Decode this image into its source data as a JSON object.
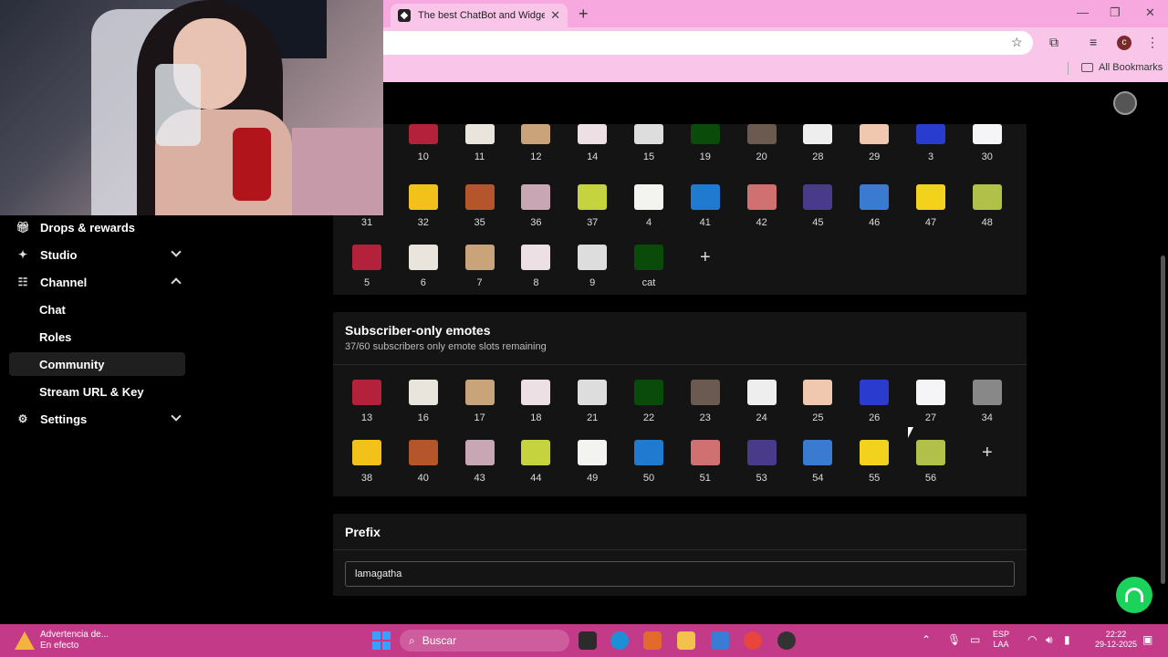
{
  "browser": {
    "tab_title": "The best ChatBot and Widgets",
    "tab_close": "✕",
    "new_tab": "+",
    "bookmarks_label": "All Bookmarks",
    "profile_initial": "c",
    "win_minimize": "—",
    "win_restore": "❐",
    "win_close": "✕"
  },
  "sidebar": {
    "items": [
      {
        "label": "Drops & rewards"
      },
      {
        "label": "Studio"
      },
      {
        "label": "Channel"
      },
      {
        "label": "Chat"
      },
      {
        "label": "Roles"
      },
      {
        "label": "Community"
      },
      {
        "label": "Stream URL & Key"
      },
      {
        "label": "Settings"
      }
    ]
  },
  "emotes_panel": {
    "rows": [
      [
        "10",
        "11",
        "12",
        "14",
        "15",
        "19",
        "20",
        "28",
        "29",
        "3",
        "30"
      ],
      [
        "31",
        "32",
        "35",
        "36",
        "37",
        "4",
        "41",
        "42",
        "45",
        "46",
        "47",
        "48"
      ],
      [
        "5",
        "6",
        "7",
        "8",
        "9",
        "cat"
      ]
    ],
    "add_label": "+"
  },
  "subscriber_panel": {
    "title": "Subscriber-only emotes",
    "subtitle": "37/60 subscribers only emote slots remaining",
    "rows": [
      [
        "13",
        "16",
        "17",
        "18",
        "21",
        "22",
        "23",
        "24",
        "25",
        "26",
        "27",
        "34"
      ],
      [
        "38",
        "40",
        "43",
        "44",
        "49",
        "50",
        "51",
        "53",
        "54",
        "55",
        "56"
      ]
    ],
    "add_label": "+"
  },
  "prefix_panel": {
    "title": "Prefix",
    "value": "lamagatha"
  },
  "taskbar": {
    "warning_title": "Advertencia de...",
    "warning_sub": "En efecto",
    "search_placeholder": "Buscar",
    "lang_top": "ESP",
    "lang_bottom": "LAA",
    "time": "22:22",
    "date": "29-12-2025"
  },
  "colors": {
    "tabstrip": "#f7a8df",
    "panel_bg": "#141414",
    "accent_green": "#1bd35a",
    "taskbar": "#c23a88"
  }
}
